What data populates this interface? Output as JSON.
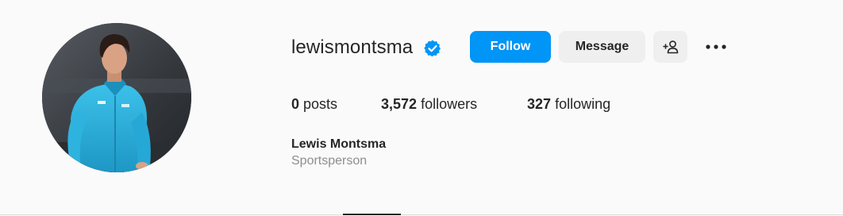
{
  "profile": {
    "username": "lewismontsma",
    "verified": true,
    "full_name": "Lewis Montsma",
    "category": "Sportsperson",
    "avatar_icon": "profile-photo"
  },
  "actions": {
    "follow_label": "Follow",
    "message_label": "Message",
    "suggest_icon": "add-person-icon",
    "more_icon": "more-options-icon"
  },
  "stats": {
    "posts_count": "0",
    "posts_label": "posts",
    "followers_count": "3,572",
    "followers_label": "followers",
    "following_count": "327",
    "following_label": "following"
  },
  "colors": {
    "follow_button": "#0095f6",
    "secondary_button": "#efefef",
    "verified_badge": "#0095f6",
    "muted_text": "#8e8e8e"
  }
}
